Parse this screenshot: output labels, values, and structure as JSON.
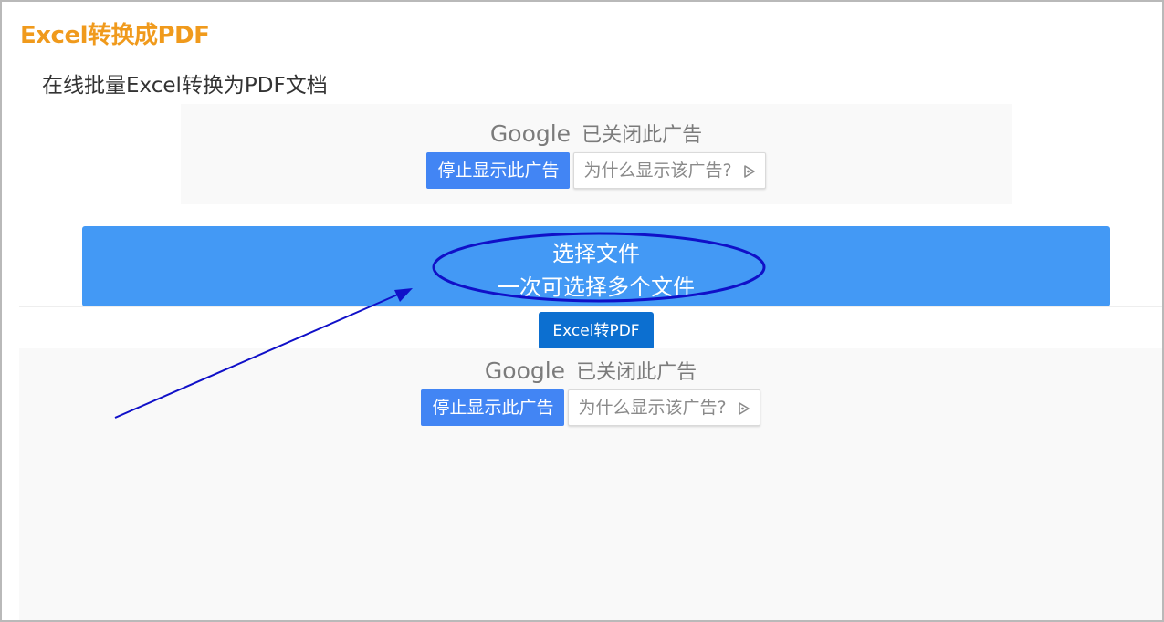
{
  "page": {
    "title": "Excel转换成PDF",
    "subtitle": "在线批量Excel转换为PDF文档"
  },
  "ads": {
    "top": {
      "brand": "Google",
      "closed_text": "已关闭此广告",
      "stop_button": "停止显示此广告",
      "why_button": "为什么显示该广告?"
    },
    "bottom": {
      "brand": "Google",
      "closed_text": "已关闭此广告",
      "stop_button": "停止显示此广告",
      "why_button": "为什么显示该广告?"
    }
  },
  "upload": {
    "title": "选择文件",
    "hint": "一次可选择多个文件"
  },
  "convert": {
    "label": "Excel转PDF"
  },
  "colors": {
    "title": "#f09a1c",
    "upload_bg": "#4399f5",
    "convert_bg": "#0c6fd0",
    "ad_button": "#4285f4",
    "annotation": "#1010c8"
  },
  "icons": {
    "adchoices": "adchoices-icon",
    "annotation_arrow": "arrow-annotation",
    "annotation_ellipse": "highlight-ellipse"
  }
}
